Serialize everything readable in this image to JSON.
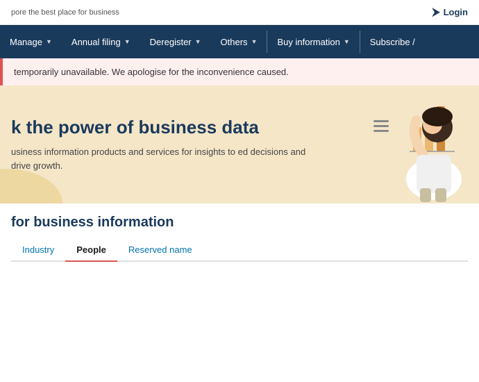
{
  "topbar": {
    "tagline": "pore the best place for business",
    "login_label": "Login"
  },
  "nav": {
    "items": [
      {
        "label": "Manage",
        "has_dropdown": true
      },
      {
        "label": "Annual filing",
        "has_dropdown": true
      },
      {
        "label": "Deregister",
        "has_dropdown": true
      },
      {
        "label": "Others",
        "has_dropdown": true
      },
      {
        "label": "Buy information",
        "has_dropdown": true
      },
      {
        "label": "Subscribe /",
        "has_dropdown": false
      }
    ]
  },
  "alert": {
    "text": "temporarily unavailable. We apologise for the inconvenience caused."
  },
  "hero": {
    "title": "k the power of business data",
    "subtitle": "usiness information products and services for insights to\ned decisions and drive growth."
  },
  "browse": {
    "title": "for business information",
    "tabs": [
      {
        "label": "Industry",
        "active": false
      },
      {
        "label": "People",
        "active": true
      },
      {
        "label": "Reserved name",
        "active": false
      }
    ]
  },
  "colors": {
    "nav_bg": "#1a3a5c",
    "hero_bg": "#f5e6c8",
    "alert_border": "#e05252",
    "alert_bg": "#fff0f0",
    "accent": "#e05252",
    "link": "#0073b1"
  }
}
